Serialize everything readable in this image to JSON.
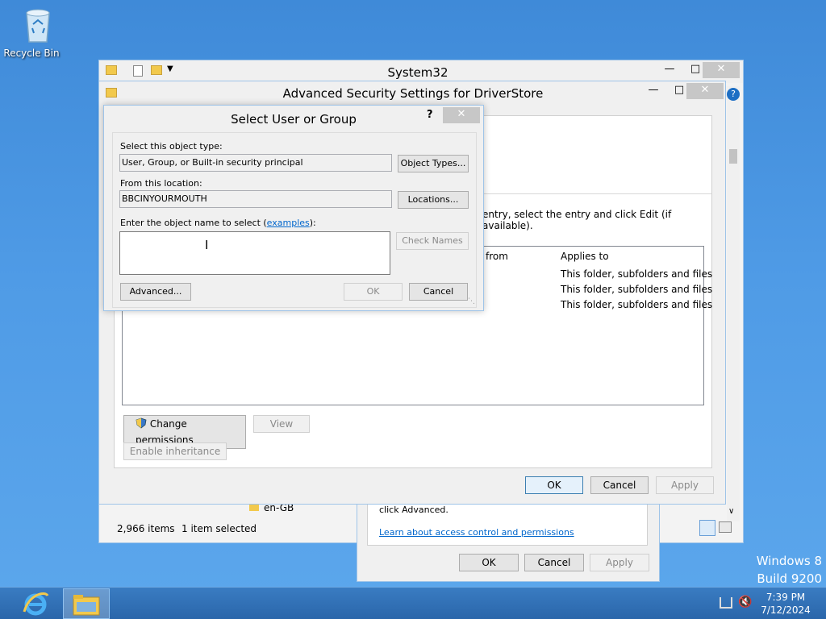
{
  "desktop": {
    "recycle_bin": "Recycle Bin",
    "watermark_line1": "Windows 8",
    "watermark_line2": "Build 9200"
  },
  "explorer": {
    "title": "System32",
    "status_items": "2,966 items",
    "status_selected": "1 item selected",
    "folder_peek": "en-GB"
  },
  "props_dialog": {
    "text": "click Advanced.",
    "link": "Learn about access control and permissions",
    "ok": "OK",
    "cancel": "Cancel",
    "apply": "Apply"
  },
  "advanced": {
    "title": "Advanced Security Settings for DriverStore",
    "instruction": "entry, select the entry and click Edit (if available).",
    "col_from": "from",
    "col_applies": "Applies to",
    "rows": [
      {
        "applies": "This folder, subfolders and files"
      },
      {
        "applies": "This folder, subfolders and files"
      },
      {
        "applies": "This folder, subfolders and files"
      }
    ],
    "change_permissions": "Change permissions",
    "view": "View",
    "enable_inheritance": "Enable inheritance",
    "ok": "OK",
    "cancel": "Cancel",
    "apply": "Apply"
  },
  "select_user": {
    "title": "Select User or Group",
    "help": "?",
    "object_type_label": "Select this object type:",
    "object_type_value": "User, Group, or Built-in security principal",
    "object_types_btn": "Object Types...",
    "location_label": "From this location:",
    "location_value": "BBCINYOURMOUTH",
    "locations_btn": "Locations...",
    "name_label_prefix": "Enter the object name to select (",
    "name_label_link": "examples",
    "name_label_suffix": "):",
    "name_value": "",
    "check_names_btn": "Check Names",
    "advanced_btn": "Advanced...",
    "ok": "OK",
    "cancel": "Cancel"
  },
  "taskbar": {
    "time": "7:39 PM",
    "date": "7/12/2024"
  },
  "colors": {
    "desktop": "#4f9be6",
    "taskbar": "#2f6eb3",
    "link": "#0066cc",
    "close_button": "#c7c7c7"
  }
}
